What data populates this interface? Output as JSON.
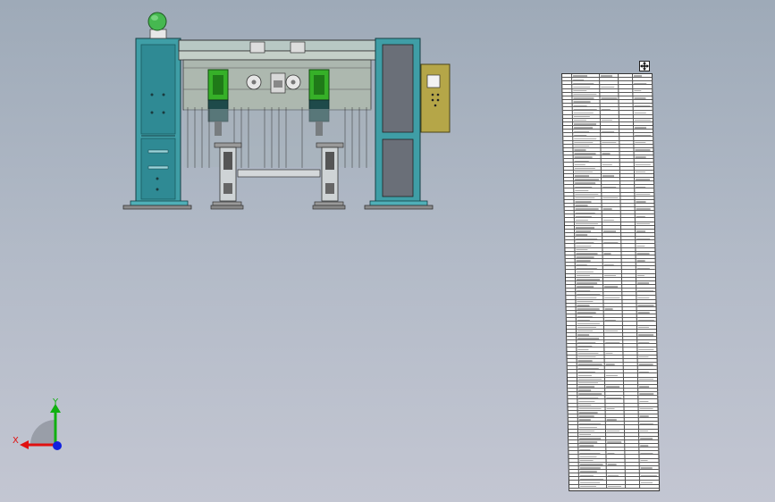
{
  "viewport": {
    "background_top": "#9eaab8",
    "background_bottom": "#c3c6d2"
  },
  "triad": {
    "x_label": "X",
    "y_label": "Y",
    "x_color": "#e01010",
    "y_color": "#10b010",
    "z_color": "#1020e0"
  },
  "bom_table": {
    "row_count": 112
  },
  "icons": {
    "move_handle": "move-arrows-icon"
  },
  "colors": {
    "frame_teal": "#3f9ea6",
    "machine_dark_teal": "#1a6a70",
    "actuator_green": "#36b028",
    "control_box": "#b5a648",
    "lamp_green": "#46b850"
  }
}
